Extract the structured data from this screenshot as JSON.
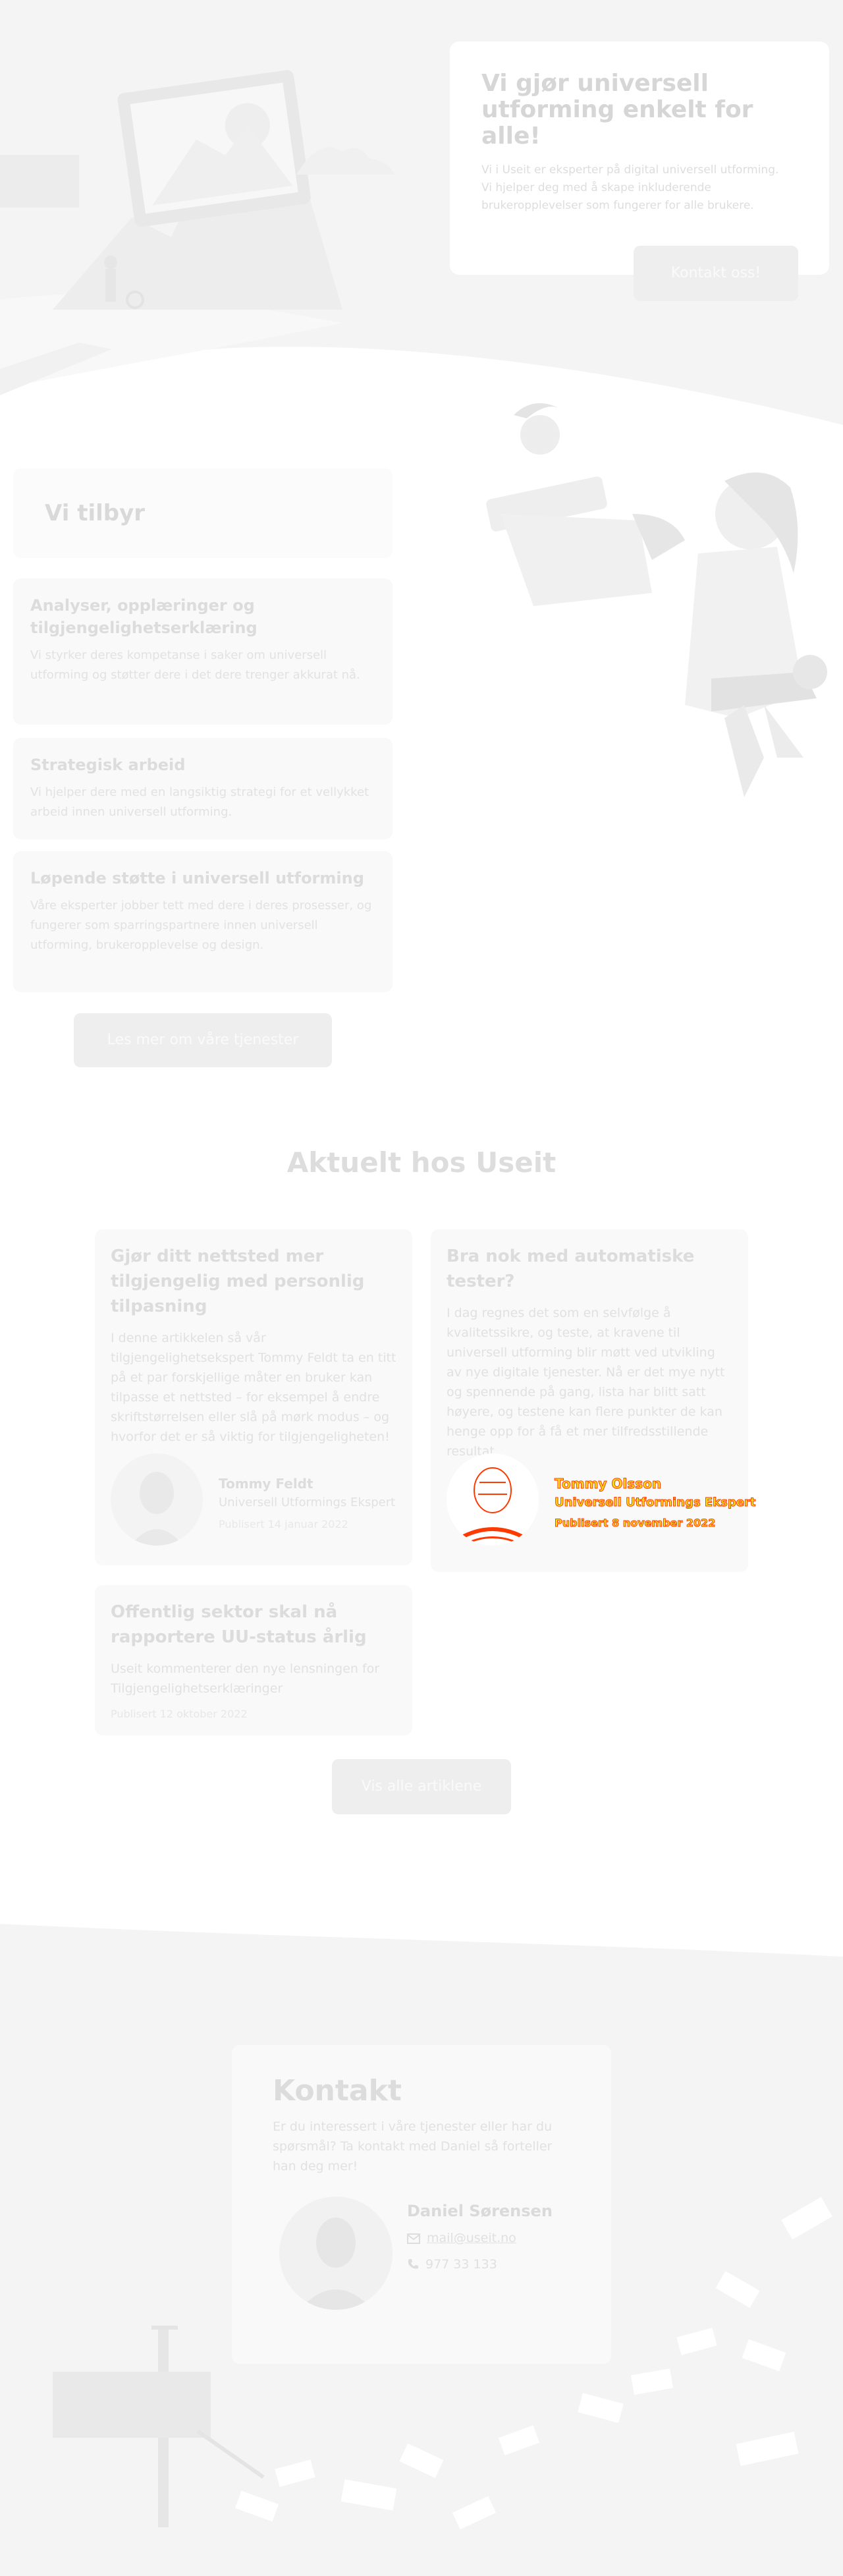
{
  "hero": {
    "title": "Vi gjør universell utforming enkelt for alle!",
    "text": "Vi i Useit er eksperter på digital universell utforming. Vi hjelper deg med å skape inkluderende brukeropplevelser som fungerer for alle brukere.",
    "button_label": "Kontakt oss!"
  },
  "offer": {
    "title": "Vi tilbyr",
    "cards": [
      {
        "title": "Analyser, opplæringer og tilgjengelighetserklæring",
        "text": "Vi styrker deres kompetanse i saker om universell utforming og støtter dere i det dere trenger akkurat nå."
      },
      {
        "title": "Strategisk arbeid",
        "text": "Vi hjelper dere med en langsiktig strategi for et vellykket arbeid innen universell utforming."
      },
      {
        "title": "Løpende støtte i universell utforming",
        "text": "Våre eksperter jobber tett med dere i deres prosesser, og fungerer som sparringspartnere innen universell utforming, brukeropplevelse og design."
      }
    ],
    "button_label": "Les mer om våre tjenester"
  },
  "news": {
    "title": "Aktuelt hos Useit",
    "articles": [
      {
        "title": "Gjør ditt nettsted mer tilgjengelig med personlig tilpasning",
        "text": "I denne artikkelen så vår tilgjengelighetsekspert Tommy Feldt ta en titt på et par forskjellige måter en bruker kan tilpasse et nettsted – for eksempel å endre skriftstørrelsen eller slå på mørk modus – og hvorfor det er så viktig for tilgjengeligheten!",
        "author_name": "Tommy Feldt",
        "author_role": "Universell Utformings Ekspert",
        "date": "Publisert 14 januar 2022"
      },
      {
        "title": "Bra nok med automatiske tester?",
        "text": "I dag regnes det som en selvfølge å kvalitetssikre, og teste, at kravene til universell utforming blir møtt ved utvikling av nye digitale tjenester. Nå er det mye nytt og spennende på gang, lista har blitt satt høyere, og testene kan flere punkter de kan henge opp for å få et mer tilfredsstillende resultat.",
        "author_name": "Tommy Olsson",
        "author_role": "Universell Utformings Ekspert",
        "date": "Publisert 8 november 2022"
      },
      {
        "title": "Offentlig sektor skal nå rapportere UU-status årlig",
        "text": "Useit kommenterer den nye lensningen for Tilgjengelighetserklæringer",
        "date": "Publisert 12 oktober 2022"
      }
    ],
    "button_label": "Vis alle artiklene"
  },
  "contact": {
    "title": "Kontakt",
    "text": "Er du interessert i våre tjenester eller har du spørsmål? Ta kontakt med Daniel så forteller han deg mer!",
    "name": "Daniel Sørensen",
    "email": "mail@useit.no",
    "phone": "977 33 133"
  },
  "icons": {
    "mail": "mail-icon",
    "phone": "phone-icon"
  },
  "colors": {
    "background_grey": "#f5f5f5",
    "card": "#f9f9f9",
    "button": "#eeeeee",
    "glitch_yellow": "#ffe01b",
    "glitch_red": "#ff3a00"
  }
}
